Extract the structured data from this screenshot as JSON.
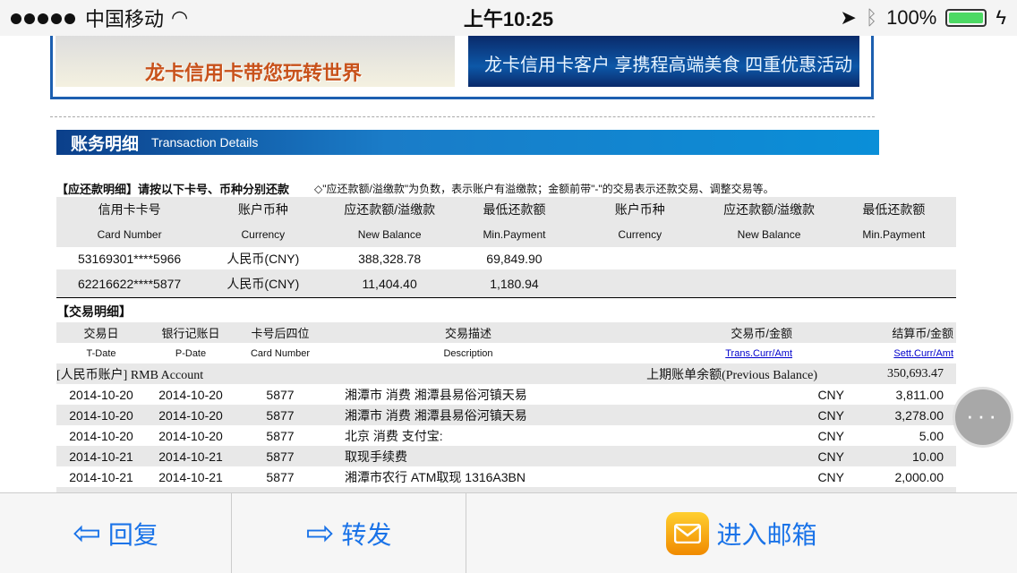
{
  "status": {
    "carrier": "中国移动",
    "time": "上午10:25",
    "battery": "100%"
  },
  "banners": {
    "left": "龙卡信用卡带您玩转世界",
    "right": "龙卡信用卡客户 享携程高端美食 四重优惠活动"
  },
  "section": {
    "title_cn": "账务明细",
    "title_en": "Transaction Details"
  },
  "repay": {
    "title": "【应还款明细】请按以下卡号、币种分别还款",
    "note": "◇\"应还款额/溢缴款\"为负数，表示账户有溢缴款；金额前带\"-\"的交易表示还款交易、调整交易等。",
    "headers_cn": [
      "信用卡卡号",
      "账户币种",
      "应还款额/溢缴款",
      "最低还款额",
      "账户币种",
      "应还款额/溢缴款",
      "最低还款额"
    ],
    "headers_en": [
      "Card Number",
      "Currency",
      "New Balance",
      "Min.Payment",
      "Currency",
      "New Balance",
      "Min.Payment"
    ],
    "rows": [
      [
        "53169301****5966",
        "人民币(CNY)",
        "388,328.78",
        "69,849.90"
      ],
      [
        "62216622****5877",
        "人民币(CNY)",
        "11,404.40",
        "1,180.94"
      ]
    ]
  },
  "trans": {
    "title": "【交易明细】",
    "headers_cn": [
      "交易日",
      "银行记账日",
      "卡号后四位",
      "交易描述",
      "交易币/金额",
      "结算币/金额"
    ],
    "headers_en": [
      "T-Date",
      "P-Date",
      "Card Number",
      "Description",
      "Trans.Curr/Amt",
      "Sett.Curr/Amt"
    ],
    "account": "[人民币账户] RMB Account",
    "prev_label": "上期账单余额(Previous Balance)",
    "prev_value": "350,693.47",
    "rows": [
      [
        "2014-10-20",
        "2014-10-20",
        "5877",
        "湘潭市 消费 湘潭县易俗河镇天易",
        "CNY",
        "3,811.00"
      ],
      [
        "2014-10-20",
        "2014-10-20",
        "5877",
        "湘潭市 消费 湘潭县易俗河镇天易",
        "CNY",
        "3,278.00"
      ],
      [
        "2014-10-20",
        "2014-10-20",
        "5877",
        "北京 消费 支付宝:",
        "CNY",
        "5.00"
      ],
      [
        "2014-10-21",
        "2014-10-21",
        "5877",
        "取现手续费",
        "CNY",
        "10.00"
      ],
      [
        "2014-10-21",
        "2014-10-21",
        "5877",
        "湘潭市农行 ATM取现 1316A3BN",
        "CNY",
        "2,000.00"
      ]
    ]
  },
  "toolbar": {
    "reply": "回复",
    "forward": "转发",
    "mailbox": "进入邮箱"
  },
  "fab": "···"
}
